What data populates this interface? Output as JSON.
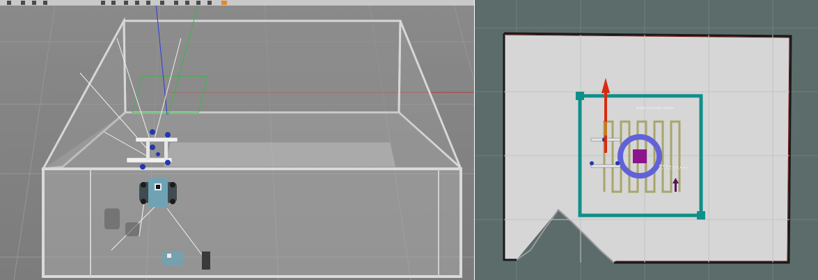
{
  "gazebo": {
    "background_color": "#7a7a7a",
    "toolbar_icons": [
      "arrow-icon",
      "translate-icon",
      "rotate-icon",
      "scale-icon",
      "undo-icon",
      "redo-icon",
      "box-shape-icon",
      "sphere-shape-icon",
      "cylinder-shape-icon",
      "light-icon",
      "copy-icon",
      "paste-icon",
      "align-icon",
      "snap-icon",
      "screenshot-icon"
    ]
  },
  "rviz": {
    "background_color": "#5b6c6a",
    "map_free_color": "#d6d6d6",
    "map_wall_color": "#1a1a1a",
    "map_border_color": "#7a1010",
    "region_color": "#0f8f8a",
    "path_color": "#a7a56a",
    "robot_circle_color": "#6262d8",
    "robot_body_color": "#8e148e",
    "heading_arrow_color": "#d92a10",
    "overlay_label": "Boltac Coverage Region"
  }
}
